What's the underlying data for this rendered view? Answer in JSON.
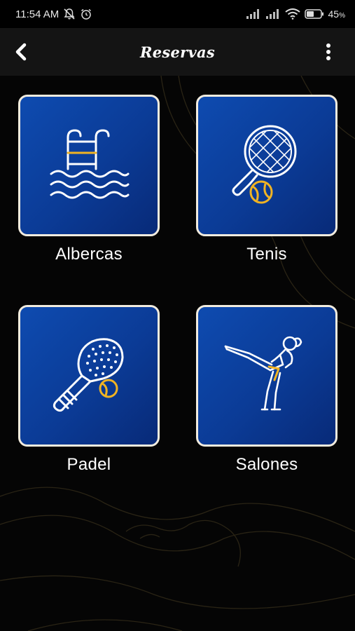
{
  "status_bar": {
    "time": "11:54 AM",
    "battery": "45"
  },
  "app_bar": {
    "title": "Reservas"
  },
  "tiles": [
    {
      "label": "Albercas",
      "icon": "pool-ladder-icon"
    },
    {
      "label": "Tenis",
      "icon": "tennis-racket-icon"
    },
    {
      "label": "Padel",
      "icon": "padel-racket-icon"
    },
    {
      "label": "Salones",
      "icon": "martial-arts-icon"
    }
  ],
  "colors": {
    "tile_blue": "#0b3b96",
    "tile_border": "#f2ecdf",
    "accent_yellow": "#f0b323",
    "background": "#050505",
    "app_bar": "#141414"
  }
}
